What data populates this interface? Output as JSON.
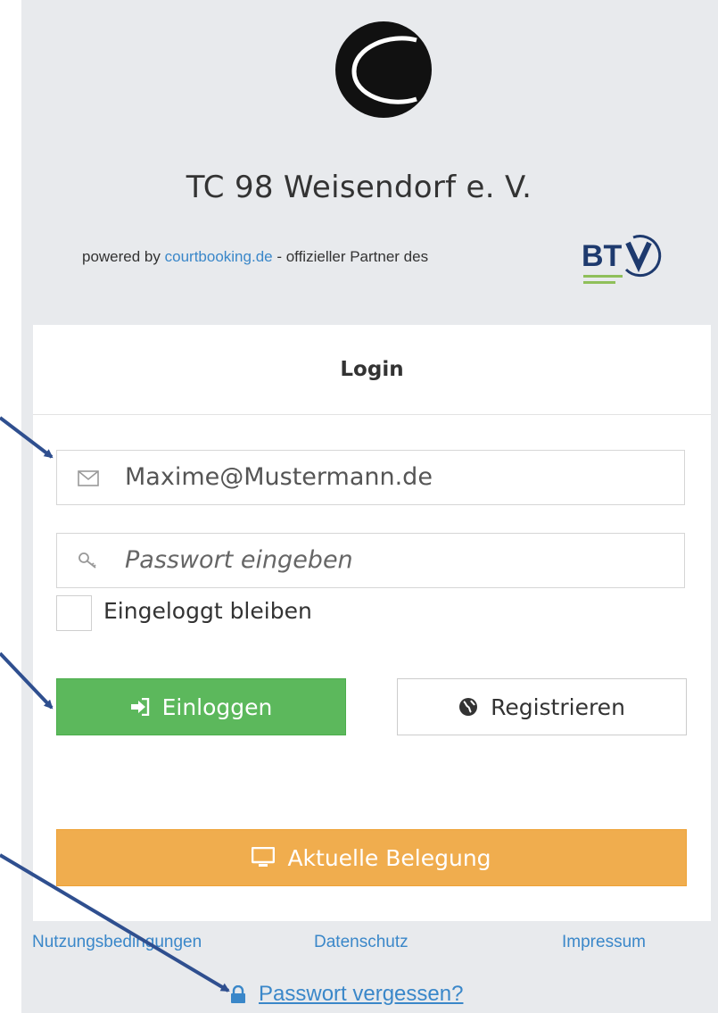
{
  "club_name": "TC 98 Weisendorf e. V.",
  "powered_by": {
    "prefix": "powered by ",
    "link": "courtbooking.de",
    "suffix": " - offizieller Partner des",
    "partner_logo_text": "BTV"
  },
  "login": {
    "title": "Login",
    "email_value": "Maxime@Mustermann.de",
    "password_placeholder": "Passwort eingeben",
    "remember_label": "Eingeloggt bleiben",
    "login_button": "Einloggen",
    "register_button": "Registrieren",
    "occupancy_button": "Aktuelle Belegung"
  },
  "footer": {
    "terms": "Nutzungsbedingungen",
    "privacy": "Datenschutz",
    "imprint": "Impressum",
    "forgot_password": "Passwort vergessen?"
  },
  "colors": {
    "login_button": "#5cb85c",
    "occupancy_button": "#f0ad4e",
    "link": "#3a87c9",
    "annotation_arrow": "#2f4f8f"
  },
  "icons": [
    "tennis-ball-logo",
    "envelope-icon",
    "key-icon",
    "sign-in-icon",
    "globe-icon",
    "monitor-icon",
    "lock-icon"
  ]
}
